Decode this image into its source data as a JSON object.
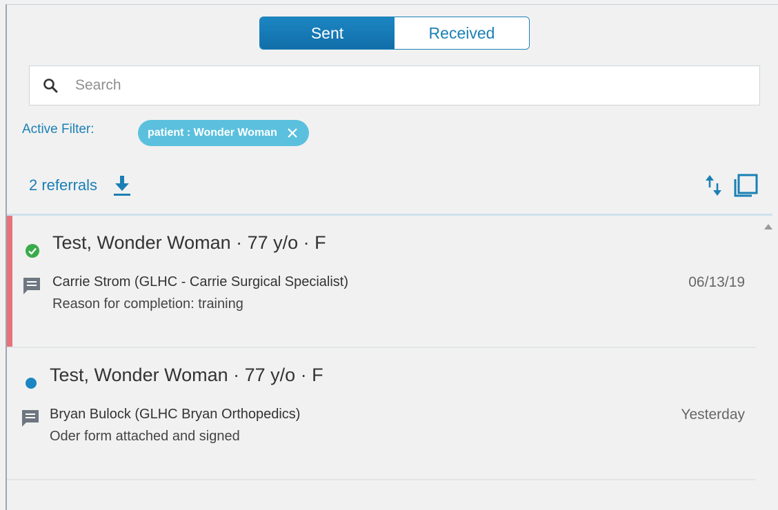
{
  "tabs": {
    "sent": "Sent",
    "received": "Received"
  },
  "search": {
    "placeholder": "Search",
    "value": ""
  },
  "filter": {
    "label": "Active Filter:",
    "chip": "patient : Wonder Woman"
  },
  "summary": {
    "count_text": "2 referrals"
  },
  "colors": {
    "accent": "#1a7fb5",
    "chip": "#5bc0de",
    "flag": "#e8727a",
    "complete": "#3aab4b",
    "unread": "#1c86c3"
  },
  "referrals": [
    {
      "title": "Test, Wonder Woman · 77 y/o · F",
      "status_icon": "check-circle-icon",
      "provider": "Carrie Strom (GLHC - Carrie Surgical Specialist)",
      "reason": "Reason for completion: training",
      "date": "06/13/19"
    },
    {
      "title": "Test, Wonder Woman · 77 y/o · F",
      "status_icon": "unread-dot-icon",
      "provider": "Bryan Bulock (GLHC Bryan Orthopedics)",
      "reason": "Oder form attached and signed",
      "date": "Yesterday"
    }
  ]
}
